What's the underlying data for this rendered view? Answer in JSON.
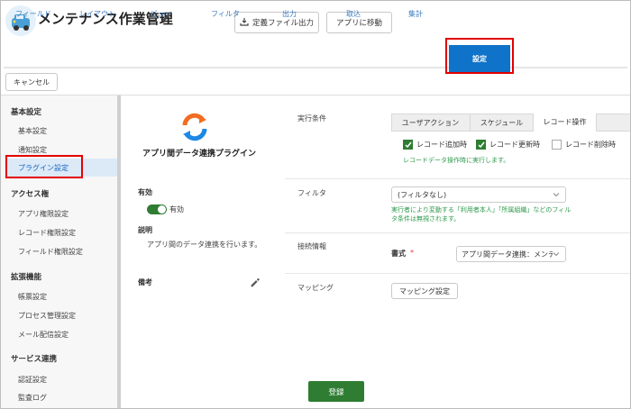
{
  "header": {
    "title": "メンテナンス作業管理",
    "export_label": "定義ファイル出力",
    "goto_app_label": "アプリに移動"
  },
  "tabs": [
    {
      "label": "フィールド"
    },
    {
      "label": "レイアウト"
    },
    {
      "label": "ビュー"
    },
    {
      "label": "フィルタ"
    },
    {
      "label": "出力"
    },
    {
      "label": "取込"
    },
    {
      "label": "集計"
    },
    {
      "label": "設定",
      "active": true
    }
  ],
  "cancel_label": "キャンセル",
  "sidebar": {
    "sections": [
      {
        "heading": "基本設定",
        "items": [
          "基本設定",
          "通知設定",
          "プラグイン設定"
        ]
      },
      {
        "heading": "アクセス権",
        "items": [
          "アプリ権限設定",
          "レコード権限設定",
          "フィールド権限設定"
        ]
      },
      {
        "heading": "拡張機能",
        "items": [
          "帳票設定",
          "プロセス管理設定",
          "メール配信設定"
        ]
      },
      {
        "heading": "サービス連携",
        "items": [
          "認証設定",
          "監査ログ"
        ]
      }
    ],
    "active_item": "プラグイン設定"
  },
  "plugin": {
    "name": "アプリ間データ連携プラグイン",
    "enabled_label": "有効",
    "enabled_value": "有効",
    "enabled": true,
    "description_label": "説明",
    "description": "アプリ間のデータ連携を行います。",
    "note_label": "備考"
  },
  "config": {
    "exec_label": "実行条件",
    "exec_tabs": [
      "ユーザアクション",
      "スケジュール",
      "レコード操作"
    ],
    "exec_active_tab": "レコード操作",
    "checkboxes": [
      {
        "label": "レコード追加時",
        "checked": true
      },
      {
        "label": "レコード更新時",
        "checked": true
      },
      {
        "label": "レコード削除時",
        "checked": false
      }
    ],
    "exec_hint": "レコードデータ操作時に実行します。",
    "filter_label": "フィルタ",
    "filter_value": "(フィルタなし)",
    "filter_hint_1": "実行者により変動する「利用者本人」「所属組織」などのフィル",
    "filter_hint_2": "タ条件は無視されます。",
    "connection_label": "接続情報",
    "format_label": "書式",
    "format_required": "*",
    "format_value": "アプリ間データ連携：メンテ",
    "mapping_label": "マッピング",
    "mapping_button": "マッピング設定",
    "save_label": "登録"
  },
  "colors": {
    "accent": "#0f73c9",
    "save": "#2e7d32",
    "highlight": "#e30000",
    "hint": "#2e9a4b"
  }
}
